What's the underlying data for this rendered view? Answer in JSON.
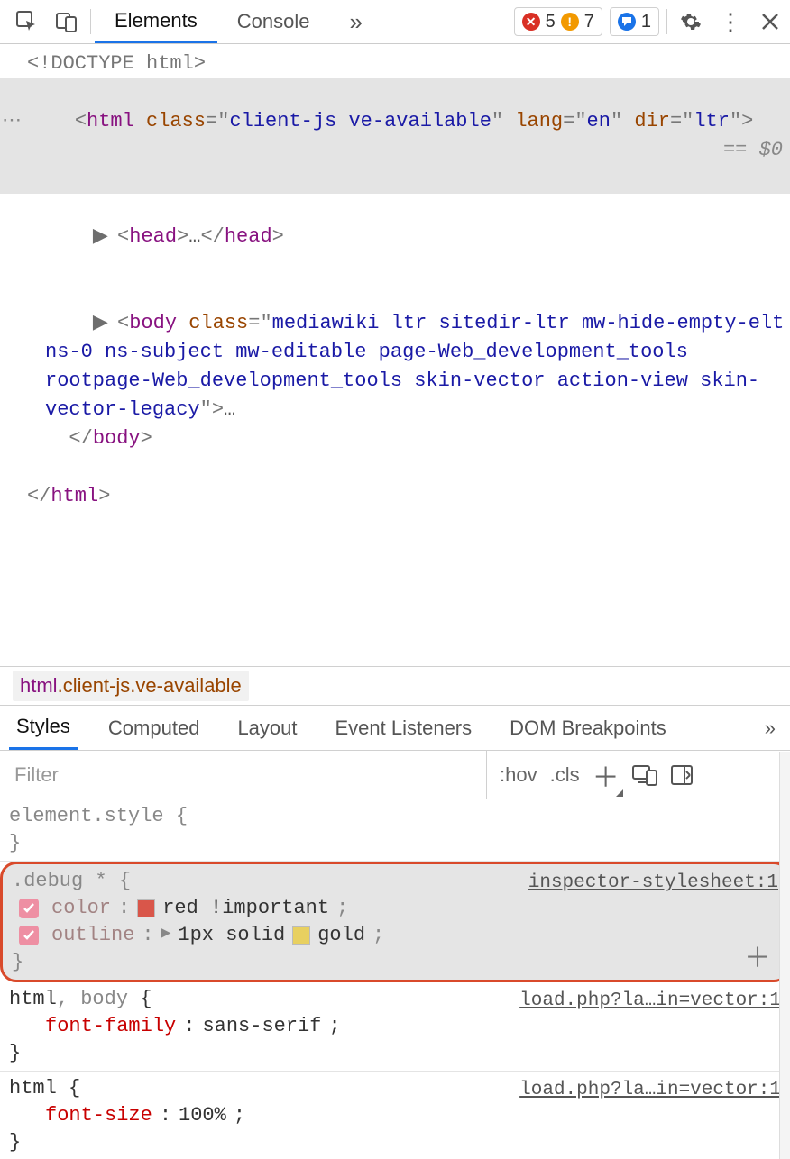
{
  "toolbar": {
    "tabs": {
      "elements": "Elements",
      "console": "Console"
    },
    "errors": "5",
    "warnings": "7",
    "messages": "1"
  },
  "dom": {
    "doctype": "<!DOCTYPE html>",
    "html_open_pre": "<",
    "html_tag": "html",
    "html_attr_class_name": "class",
    "html_attr_class_val": "client-js ve-available",
    "html_attr_lang_name": "lang",
    "html_attr_lang_val": "en",
    "html_attr_dir_name": "dir",
    "html_attr_dir_val": "ltr",
    "eqvar": "$0",
    "head_open": "<head>",
    "head_close": "</head>",
    "body_tag": "body",
    "body_attr_name": "class",
    "body_attr_val": "mediawiki ltr sitedir-ltr mw-hide-empty-elt ns-0 ns-subject mw-editable page-Web_development_tools rootpage-Web_development_tools skin-vector action-view skin-vector-legacy",
    "body_close": "</body>",
    "html_close": "</html>"
  },
  "crumb": {
    "tag": "html",
    "cls1": "client-js",
    "cls2": "ve-available"
  },
  "subtabs": {
    "styles": "Styles",
    "computed": "Computed",
    "layout": "Layout",
    "listeners": "Event Listeners",
    "dom_bp": "DOM Breakpoints"
  },
  "filter": {
    "placeholder": "Filter",
    "hov": ":hov",
    "cls": ".cls"
  },
  "styles": {
    "element_style": "element.style",
    "debug": {
      "selector": ".debug *",
      "src": "inspector-stylesheet:1",
      "p1_name": "color",
      "p1_val": "red !important",
      "p1_swatch": "#d9564a",
      "p2_name": "outline",
      "p2_val": "1px solid ",
      "p2_val2": "gold",
      "p2_swatch": "#e8d060"
    },
    "htmlbody": {
      "selector": "html, body",
      "src": "load.php?la…in=vector:1",
      "p1_name": "font-family",
      "p1_val": "sans-serif"
    },
    "htmlrule": {
      "selector": "html",
      "src": "load.php?la…in=vector:1",
      "p1_name": "font-size",
      "p1_val": "100%"
    }
  }
}
